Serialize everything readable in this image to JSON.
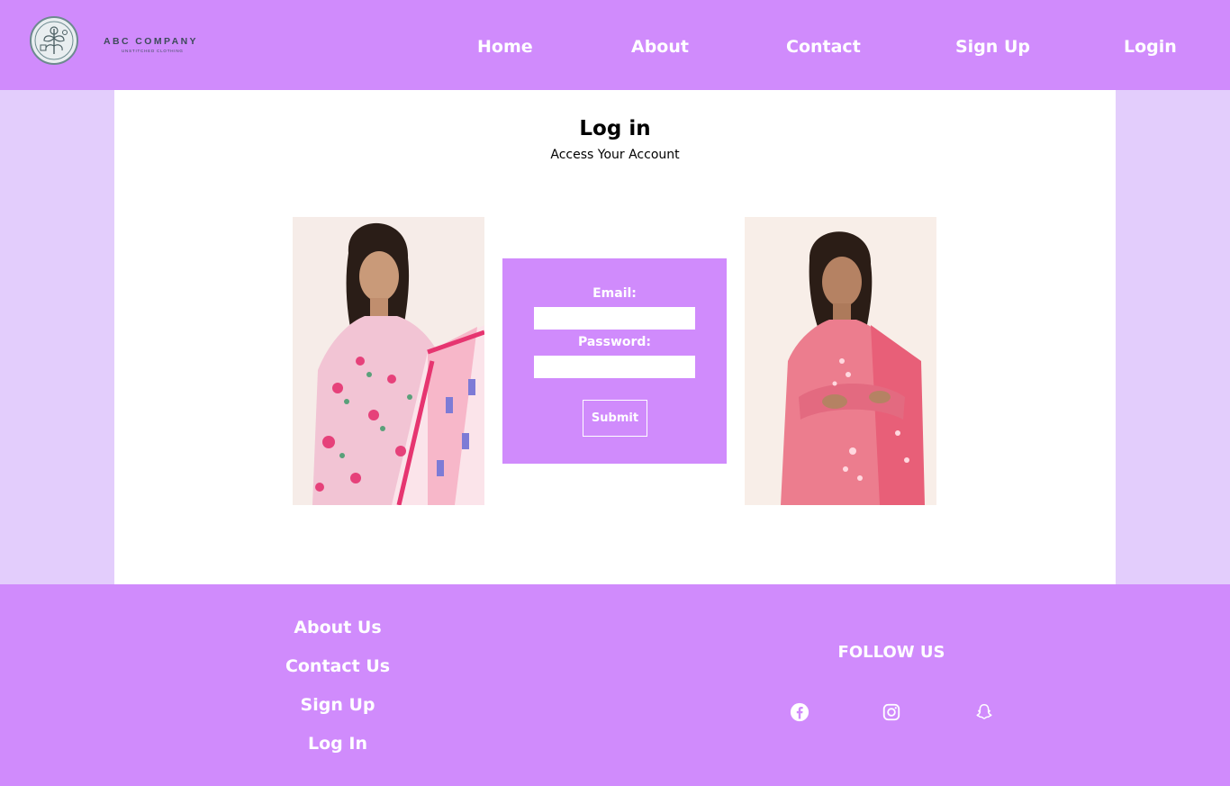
{
  "brand": {
    "name": "ABC COMPANY",
    "tagline": "UNSTITCHED CLOTHING"
  },
  "nav": {
    "items": [
      "Home",
      "About",
      "Contact",
      "Sign Up",
      "Login"
    ]
  },
  "page": {
    "title": "Log in",
    "subtitle": "Access Your Account"
  },
  "form": {
    "email_label": "Email:",
    "email_value": "",
    "password_label": "Password:",
    "password_value": "",
    "submit_label": "Submit"
  },
  "footer": {
    "links": [
      "About Us",
      "Contact Us",
      "Sign Up",
      "Log In"
    ],
    "follow_heading": "FOLLOW US",
    "social_icons": [
      "facebook-icon",
      "instagram-icon",
      "snapchat-icon"
    ]
  },
  "colors": {
    "primary": "#d08bfc",
    "page_background": "#e3cdfc",
    "content_background": "#ffffff",
    "text_light": "#ffffff"
  }
}
